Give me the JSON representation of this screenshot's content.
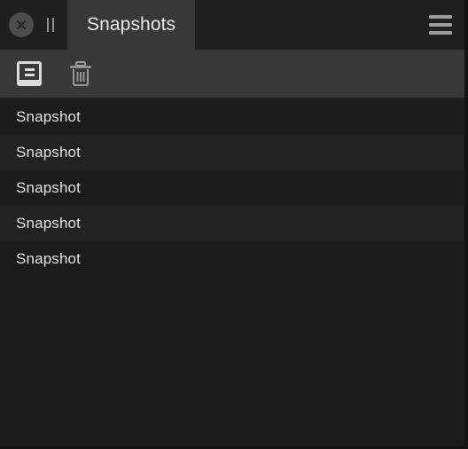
{
  "window": {
    "theme": "dark",
    "colors": {
      "tabbar_bg": "#1f1f1f",
      "tab_active_bg": "#383838",
      "toolbar_bg": "#383838",
      "list_bg_odd": "#1b1b1b",
      "list_bg_even": "#222222",
      "text": "#e2e2e2",
      "icon": "#9b9b9b",
      "frame": "#131313"
    }
  },
  "tabbar": {
    "close_icon": "close-circle-icon",
    "grip_icon": "pause-grip-icon",
    "tabs": [
      {
        "label": "Snapshots",
        "active": true
      }
    ],
    "menu_icon": "hamburger-menu-icon"
  },
  "toolbar": {
    "buttons": [
      {
        "name": "take-snapshot-button",
        "icon": "snapshot-icon",
        "label": ""
      },
      {
        "name": "delete-snapshot-button",
        "icon": "trash-icon",
        "label": ""
      }
    ]
  },
  "list": {
    "rows": [
      {
        "label": "Snapshot"
      },
      {
        "label": "Snapshot"
      },
      {
        "label": "Snapshot"
      },
      {
        "label": "Snapshot"
      },
      {
        "label": "Snapshot"
      }
    ]
  }
}
